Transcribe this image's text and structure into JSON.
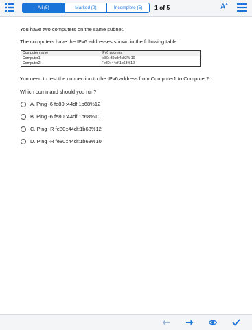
{
  "topbar": {
    "tabs": [
      {
        "label": "All (5)",
        "active": true
      },
      {
        "label": "Marked (0)",
        "active": false
      },
      {
        "label": "Incomplete (5)",
        "active": false
      }
    ],
    "pager": "1 of 5"
  },
  "question": {
    "intro": "You have two computers on the same subnet.",
    "table_intro": "The computers have the IPv6 addresses shown in the following table:",
    "table": {
      "headers": [
        "Computer name",
        "IPv6 address"
      ],
      "rows": [
        [
          "Computer1",
          "fe80::39cd:4c03% 10"
        ],
        [
          "Computer2",
          "Fe80::44df:1b68%12"
        ]
      ]
    },
    "task": "You need to test the connection to the IPv6 address from Computer1 to Computer2.",
    "prompt": "Which command should you run?",
    "options": [
      "A. Ping -6 fe80::44df:1b68%12",
      "B. Ping -6 fe80::44df:1b68%10",
      "C. Ping -R fe80::44df:1b68%12",
      "D. Ping -R fe80::44df:1b68%10"
    ]
  },
  "colors": {
    "accent": "#1a73d9",
    "bar_bg": "#f4f5f7",
    "disabled": "#9fb7d6"
  },
  "icons": [
    "list-icon",
    "font-size-icon",
    "menu-icon",
    "back-arrow-icon",
    "forward-arrow-icon",
    "eye-icon",
    "check-icon"
  ]
}
